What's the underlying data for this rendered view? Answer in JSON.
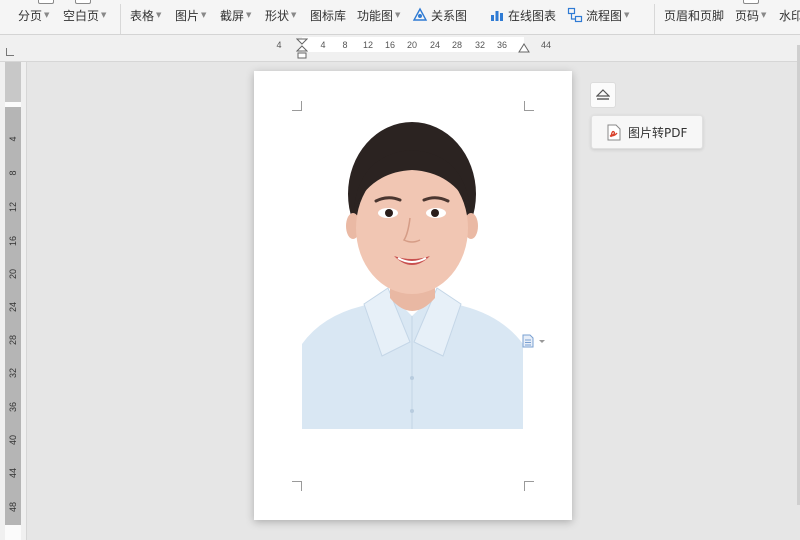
{
  "ribbon": {
    "items": [
      {
        "label": "分页",
        "dropdown": true
      },
      {
        "label": "空白页",
        "dropdown": true
      },
      {
        "label": "表格",
        "dropdown": true
      },
      {
        "label": "图片",
        "dropdown": true
      },
      {
        "label": "截屏",
        "dropdown": true
      },
      {
        "label": "形状",
        "dropdown": true
      },
      {
        "label": "图标库",
        "dropdown": false
      },
      {
        "label": "功能图",
        "dropdown": true
      },
      {
        "label": "关系图",
        "dropdown": false,
        "icon": "relation-diagram-icon"
      },
      {
        "label": "在线图表",
        "dropdown": false,
        "icon": "online-chart-icon"
      },
      {
        "label": "流程图",
        "dropdown": true,
        "icon": "flowchart-icon"
      },
      {
        "label": "页眉和页脚",
        "dropdown": false
      },
      {
        "label": "页码",
        "dropdown": true
      },
      {
        "label": "水印",
        "dropdown": false
      }
    ]
  },
  "ruler": {
    "horizontal": [
      "4",
      "4",
      "8",
      "12",
      "16",
      "20",
      "24",
      "28",
      "32",
      "36",
      "44"
    ],
    "vertical": [
      "4",
      "8",
      "12",
      "16",
      "20",
      "24",
      "28",
      "32",
      "36",
      "40",
      "44",
      "48"
    ]
  },
  "float_buttons": {
    "pdf_label": "图片转PDF"
  },
  "colors": {
    "accent": "#2f7bd4",
    "pdf_red": "#d9402b",
    "shirt": "#d9e7f3"
  }
}
